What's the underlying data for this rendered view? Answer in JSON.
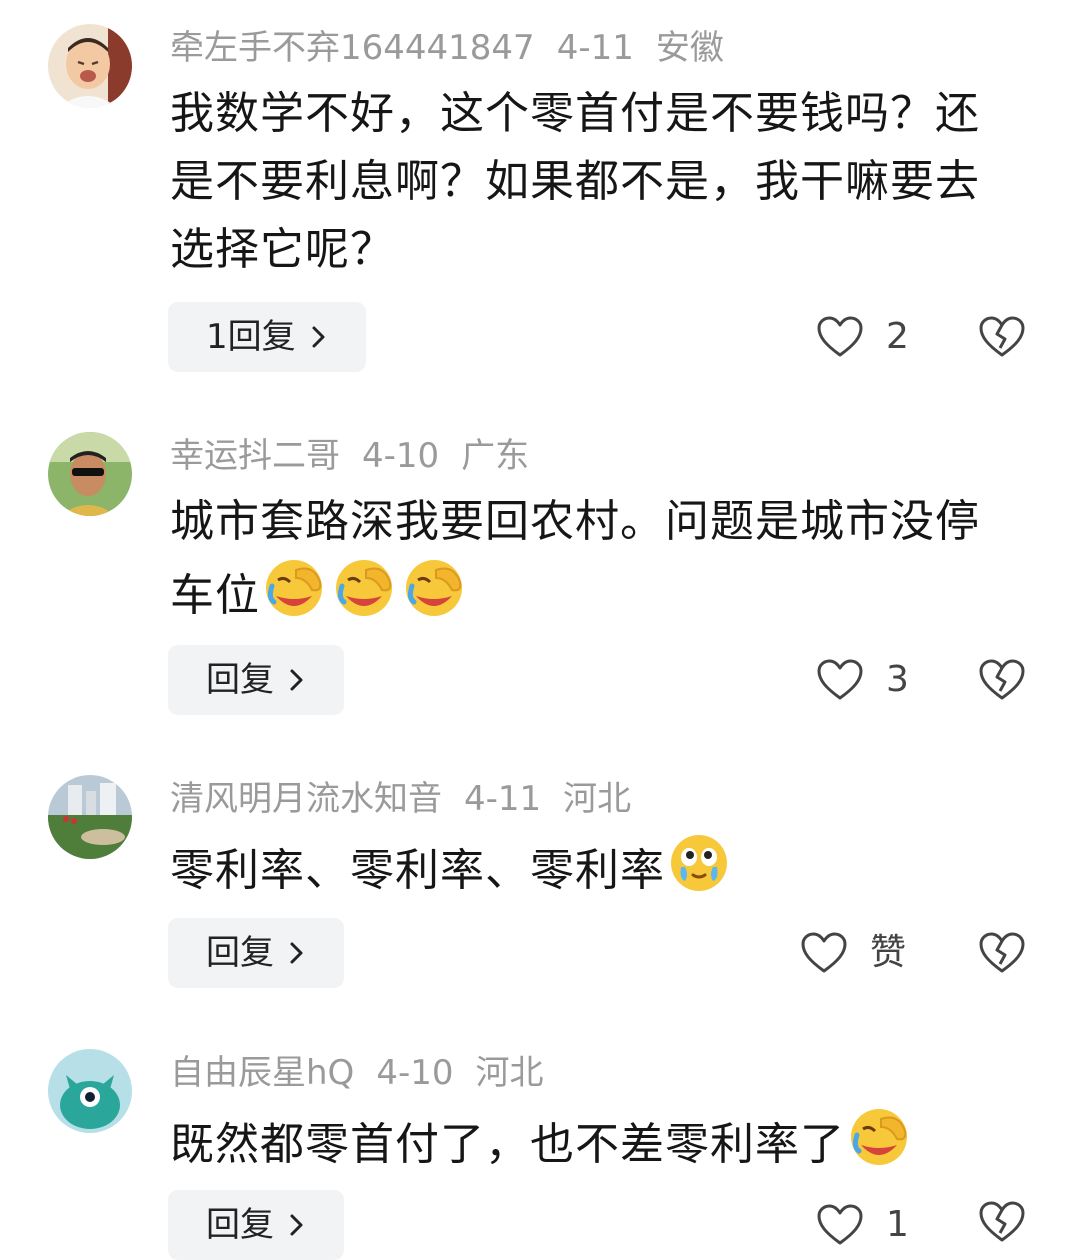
{
  "comments": [
    {
      "username": "牵左手不弃164441847",
      "date": "4-11",
      "location": "安徽",
      "text_lines": [
        "我数学不好，这个零首付是不要钱吗？还",
        "是不要利息啊？如果都不是，我干嘛要去",
        "选择它呢？"
      ],
      "reply_label": "1回复",
      "like_count": "2",
      "emojis": []
    },
    {
      "username": "幸运抖二哥",
      "date": "4-10",
      "location": "广东",
      "text_lines": [
        "城市套路深我要回农村。问题是城市没停",
        "车位"
      ],
      "reply_label": "回复",
      "like_count": "3",
      "emojis": [
        "facepalm-laugh-emoji",
        "facepalm-laugh-emoji",
        "facepalm-laugh-emoji"
      ]
    },
    {
      "username": "清风明月流水知音",
      "date": "4-11",
      "location": "河北",
      "text_lines": [
        "零利率、零利率、零利率"
      ],
      "reply_label": "回复",
      "like_count": "赞",
      "emojis": [
        "tearful-smile-emoji"
      ]
    },
    {
      "username": "自由辰星hQ",
      "date": "4-10",
      "location": "河北",
      "text_lines": [
        "既然都零首付了，也不差零利率了"
      ],
      "reply_label": "回复",
      "like_count": "1",
      "emojis": [
        "facepalm-laugh-emoji"
      ]
    }
  ],
  "colors": {
    "meta_text": "#9a9a9a",
    "reply_button_bg": "#f2f3f5",
    "body_text": "#161616"
  }
}
